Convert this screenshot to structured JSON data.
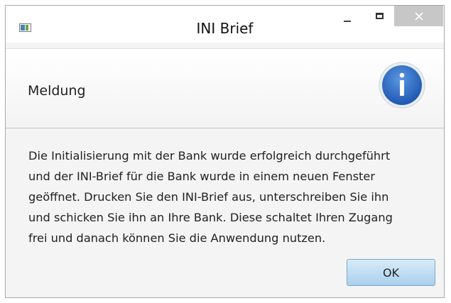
{
  "window": {
    "title": "INI Brief",
    "app_icon": "app-window-icon",
    "controls": {
      "minimize_icon": "minimize-icon",
      "maximize_icon": "maximize-icon",
      "close_icon": "close-icon"
    }
  },
  "header": {
    "text": "Meldung",
    "icon": "info-icon",
    "icon_color": "#2f6fc6"
  },
  "message": {
    "lines": [
      "Die Initialisierung mit der Bank wurde erfolgreich durchgeführt",
      "und der INI-Brief für die Bank wurde in einem neuen Fenster",
      "geöffnet. Drucken Sie den INI-Brief aus, unterschreiben Sie ihn",
      "und schicken Sie ihn an Ihre Bank. Diese schaltet Ihren Zugang",
      "frei und danach können Sie die Anwendung nutzen."
    ]
  },
  "buttons": {
    "ok_label": "OK",
    "accent": "#a9d0ee"
  }
}
